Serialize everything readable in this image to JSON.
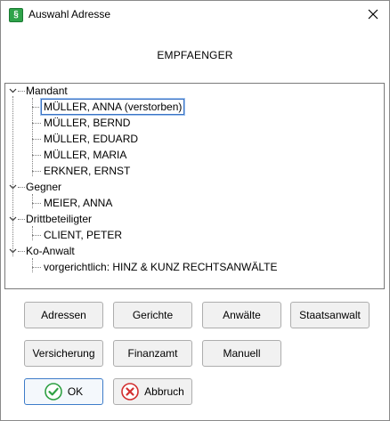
{
  "window": {
    "title": "Auswahl Adresse",
    "app_icon_glyph": "§",
    "icons": {
      "app": "app-logo-icon",
      "close": "close-icon"
    }
  },
  "recipient_label": "EMPFAENGER",
  "tree": {
    "groups": [
      {
        "label": "Mandant",
        "items": [
          "MÜLLER, ANNA (verstorben)",
          "MÜLLER, BERND",
          "MÜLLER, EDUARD",
          "MÜLLER, MARIA",
          "ERKNER, ERNST"
        ]
      },
      {
        "label": "Gegner",
        "items": [
          "MEIER, ANNA"
        ]
      },
      {
        "label": "Drittbeteiligter",
        "items": [
          "CLIENT, PETER"
        ]
      },
      {
        "label": "Ko-Anwalt",
        "items": [
          "vorgerichtlich: HINZ & KUNZ RECHTSANWÄLTE"
        ]
      }
    ],
    "selected": "MÜLLER, ANNA (verstorben)"
  },
  "buttons": {
    "adressen": "Adressen",
    "gerichte": "Gerichte",
    "anwaelte": "Anwälte",
    "staatsanwalt": "Staatsanwalt",
    "versicherung": "Versicherung",
    "finanzamt": "Finanzamt",
    "manuell": "Manuell",
    "ok": "OK",
    "abbruch": "Abbruch"
  },
  "colors": {
    "ok_check": "#2ea043",
    "cancel_x": "#d32f2f",
    "selection_border": "#3b73c4"
  }
}
